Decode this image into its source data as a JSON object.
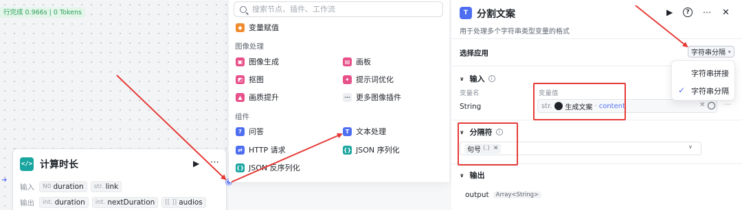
{
  "canvas": {
    "run_status": "行完成 0.966s | 0 Tokens",
    "node": {
      "icon": "</>",
      "title": "计算时长",
      "input_label": "输入",
      "output_label": "输出",
      "inputs": [
        {
          "type": "N0",
          "name": "duration"
        },
        {
          "type": "str.",
          "name": "link"
        }
      ],
      "outputs": [
        {
          "type": "int.",
          "name": "duration"
        },
        {
          "type": "int.",
          "name": "nextDuration"
        },
        {
          "type": "[[ ]]",
          "name": "audios"
        }
      ]
    }
  },
  "menu": {
    "search_placeholder": "搜索节点、插件、工作流",
    "top_item": "变量赋值",
    "image_section": "图像处理",
    "image_items": [
      "图像生成",
      "画板",
      "抠图",
      "提示词优化",
      "画质提升",
      "更多图像插件"
    ],
    "component_section": "组件",
    "component_items": [
      "问答",
      "文本处理",
      "HTTP 请求",
      "JSON 序列化",
      "JSON 反序列化"
    ]
  },
  "panel": {
    "title": "分割文案",
    "description": "用于处理多个字符串类型变量的格式",
    "select_app_label": "选择应用",
    "select_value": "字符串分隔",
    "dropdown_options": [
      "字符串拼接",
      "字符串分隔"
    ],
    "dropdown_selected": "字符串分隔",
    "input_section": "输入",
    "var_name_header": "变量名",
    "var_value_header": "变量值",
    "var_name": "String",
    "var_value_type": "str.",
    "var_value_source": "生成文案",
    "var_value_key": "content",
    "separator_section": "分隔符",
    "separator_chip": "句号",
    "separator_value": "(.)",
    "output_section": "输出",
    "output_name": "output",
    "output_type": "Array<String>"
  },
  "colors": {
    "accent": "#4e6ef2",
    "highlight_red": "#e53935",
    "success_green": "#2f9e5c",
    "node_icon_teal": "#19a5a0"
  }
}
